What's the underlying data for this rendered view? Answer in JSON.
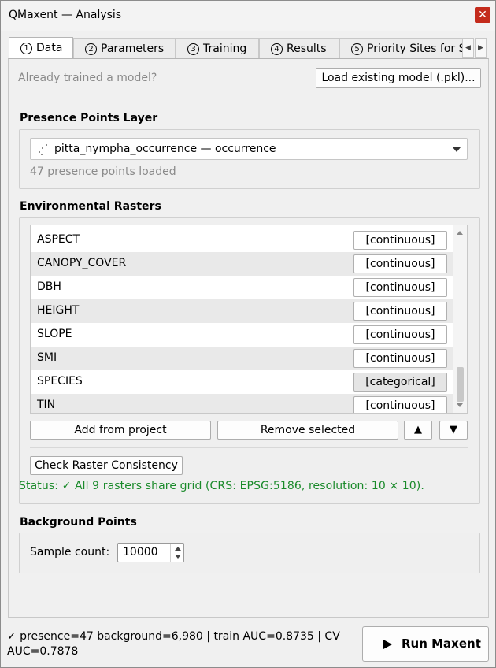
{
  "window": {
    "title": "QMaxent — Analysis",
    "close_glyph": "✕"
  },
  "tabs": [
    {
      "num": "1",
      "label": "Data"
    },
    {
      "num": "2",
      "label": "Parameters"
    },
    {
      "num": "3",
      "label": "Training"
    },
    {
      "num": "4",
      "label": "Results"
    },
    {
      "num": "5",
      "label": "Priority Sites for S"
    }
  ],
  "tab_scroll": {
    "left": "◀",
    "right": "▶"
  },
  "data_tab": {
    "trained_prompt": "Already trained a model?",
    "load_model_button": "Load existing model (.pkl)...",
    "presence": {
      "title": "Presence Points Layer",
      "selected_layer": "pitta_nympha_occurrence — occurrence",
      "layer_icon": "point-layer-icon",
      "loaded_text": "47 presence points loaded"
    },
    "rasters": {
      "title": "Environmental Rasters",
      "items": [
        {
          "name": "ASPECT",
          "type": "[continuous]"
        },
        {
          "name": "CANOPY_COVER",
          "type": "[continuous]"
        },
        {
          "name": "DBH",
          "type": "[continuous]"
        },
        {
          "name": "HEIGHT",
          "type": "[continuous]"
        },
        {
          "name": "SLOPE",
          "type": "[continuous]"
        },
        {
          "name": "SMI",
          "type": "[continuous]"
        },
        {
          "name": "SPECIES",
          "type": "[categorical]"
        },
        {
          "name": "TIN",
          "type": "[continuous]"
        }
      ],
      "add_button": "Add from project",
      "remove_button": "Remove selected",
      "move_up": "▲",
      "move_down": "▼",
      "check_button": "Check Raster Consistency",
      "status_text": "Status: ✓ All 9 rasters share grid (CRS: EPSG:5186, resolution: 10 × 10).",
      "status_color": "#1a8a2a"
    },
    "background": {
      "title": "Background Points",
      "sample_label": "Sample count:",
      "sample_value": "10000"
    }
  },
  "footer": {
    "status_text": "✓ presence=47  background=6,980  |  train AUC=0.8735  |  CV AUC=0.7878",
    "run_button": "Run Maxent"
  }
}
